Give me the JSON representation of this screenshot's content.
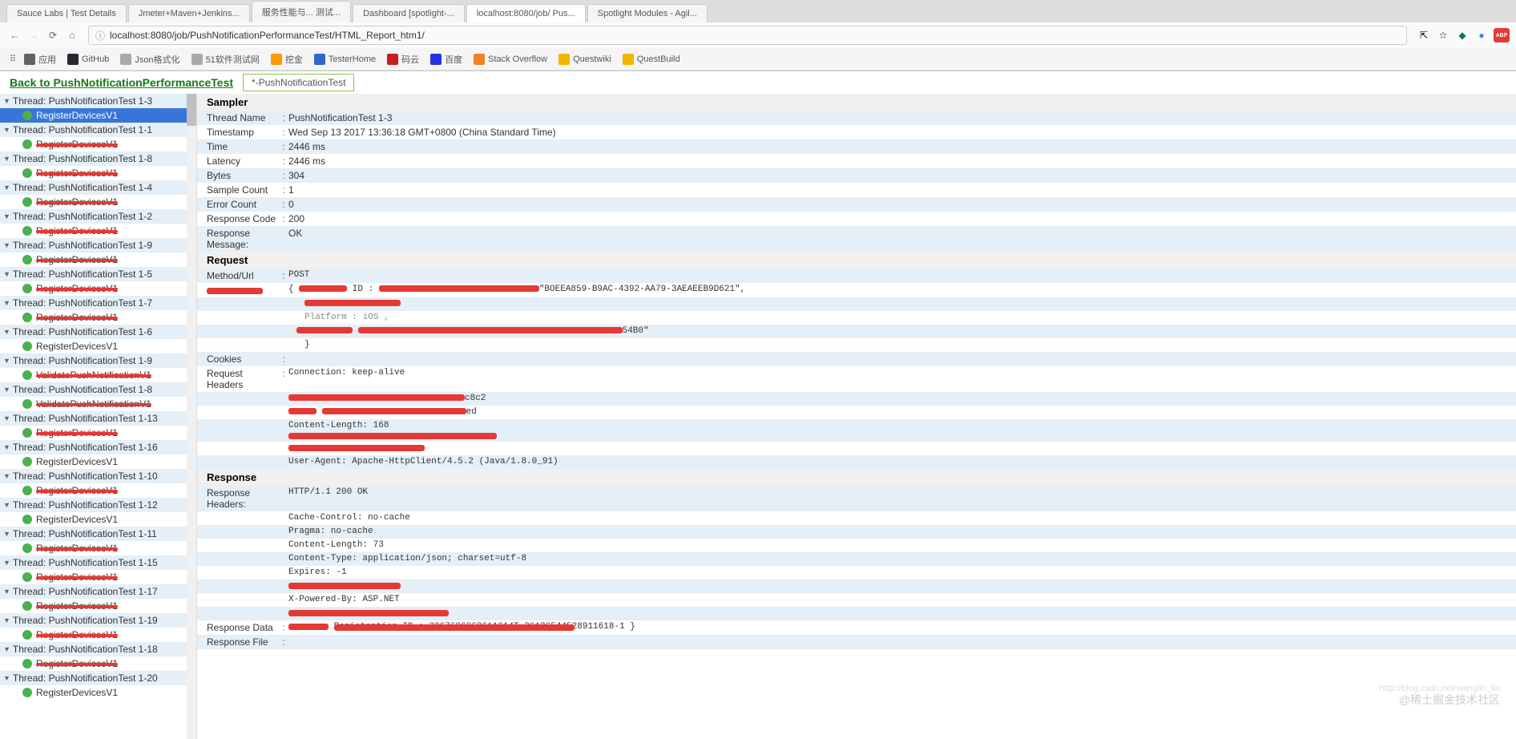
{
  "browser": {
    "url": "localhost:8080/job/PushNotificationPerformanceTest/HTML_Report_htm1/",
    "tabs": [
      {
        "label": "Sauce Labs | Test Details"
      },
      {
        "label": "Jmeter+Maven+Jenkins..."
      },
      {
        "label": "服务性能与... 测试..."
      },
      {
        "label": "Dashboard [spotlight-..."
      },
      {
        "label": "localhost:8080/job/ Pus..."
      },
      {
        "label": "Spotlight Modules - Agil..."
      }
    ],
    "bookmarks": [
      {
        "label": "应用",
        "color": "#5f6368"
      },
      {
        "label": "GitHub",
        "color": "#24292e"
      },
      {
        "label": "Json格式化",
        "color": "#aaa"
      },
      {
        "label": "51软件测试网",
        "color": "#aaa"
      },
      {
        "label": "挖金",
        "color": "#f90"
      },
      {
        "label": "TesterHome",
        "color": "#36c"
      },
      {
        "label": "码云",
        "color": "#c71d23"
      },
      {
        "label": "百度",
        "color": "#2932e1"
      },
      {
        "label": "Stack Overflow",
        "color": "#f48024"
      },
      {
        "label": "Questwiki",
        "color": "#f4b400"
      },
      {
        "label": "QuestBuild",
        "color": "#f4b400"
      }
    ]
  },
  "header": {
    "back_link": "Back to PushNotificationPerformanceTest",
    "tab": "*-PushNotificationTest"
  },
  "tree": [
    {
      "t": "thread",
      "label": "Thread: PushNotificationTest 1-3",
      "sel": false
    },
    {
      "t": "leaf",
      "label": "RegisterDevicesV1",
      "sel": true,
      "red": false
    },
    {
      "t": "thread",
      "label": "Thread: PushNotificationTest 1-1"
    },
    {
      "t": "leaf",
      "label": "RegisterDevicesV1",
      "red": true
    },
    {
      "t": "thread",
      "label": "Thread: PushNotificationTest 1-8"
    },
    {
      "t": "leaf",
      "label": "RegisterDevicesV1",
      "red": true
    },
    {
      "t": "thread",
      "label": "Thread: PushNotificationTest 1-4"
    },
    {
      "t": "leaf",
      "label": "RegisterDevicesV1",
      "red": true
    },
    {
      "t": "thread",
      "label": "Thread: PushNotificationTest 1-2"
    },
    {
      "t": "leaf",
      "label": "RegisterDevicesV1",
      "red": true,
      "short": true
    },
    {
      "t": "thread",
      "label": "Thread: PushNotificationTest 1-9"
    },
    {
      "t": "leaf",
      "label": "RegisterDevicesV1",
      "red": true,
      "short": true
    },
    {
      "t": "thread",
      "label": "Thread: PushNotificationTest 1-5"
    },
    {
      "t": "leaf",
      "label": "RegisterDevicesV1",
      "red": true
    },
    {
      "t": "thread",
      "label": "Thread: PushNotificationTest 1-7"
    },
    {
      "t": "leaf",
      "label": "RegisterDevicesV1",
      "red": true
    },
    {
      "t": "thread",
      "label": "Thread: PushNotificationTest 1-6"
    },
    {
      "t": "leaf",
      "label": "RegisterDevicesV1",
      "red": false
    },
    {
      "t": "thread",
      "label": "Thread: PushNotificationTest 1-9"
    },
    {
      "t": "leaf",
      "label": "ValidatePushNotificationV1",
      "red": true
    },
    {
      "t": "thread",
      "label": "Thread: PushNotificationTest 1-8"
    },
    {
      "t": "leaf",
      "label": "ValidatePushNotificationV1",
      "red": true
    },
    {
      "t": "thread",
      "label": "Thread: PushNotificationTest 1-13"
    },
    {
      "t": "leaf",
      "label": "RegisterDevicesV1",
      "red": true,
      "short": true
    },
    {
      "t": "thread",
      "label": "Thread: PushNotificationTest 1-16"
    },
    {
      "t": "leaf",
      "label": "RegisterDevicesV1",
      "red": false
    },
    {
      "t": "thread",
      "label": "Thread: PushNotificationTest 1-10"
    },
    {
      "t": "leaf",
      "label": "RegisterDevicesV1",
      "red": true
    },
    {
      "t": "thread",
      "label": "Thread: PushNotificationTest 1-12"
    },
    {
      "t": "leaf",
      "label": "RegisterDevicesV1",
      "red": false
    },
    {
      "t": "thread",
      "label": "Thread: PushNotificationTest 1-11"
    },
    {
      "t": "leaf",
      "label": "RegisterDevicesV1",
      "red": true
    },
    {
      "t": "thread",
      "label": "Thread: PushNotificationTest 1-15"
    },
    {
      "t": "leaf",
      "label": "RegisterDevicesV1",
      "red": true,
      "short": true
    },
    {
      "t": "thread",
      "label": "Thread: PushNotificationTest 1-17"
    },
    {
      "t": "leaf",
      "label": "RegisterDevicesV1",
      "red": true
    },
    {
      "t": "thread",
      "label": "Thread: PushNotificationTest 1-19"
    },
    {
      "t": "leaf",
      "label": "RegisterDevicesV1",
      "red": true
    },
    {
      "t": "thread",
      "label": "Thread: PushNotificationTest 1-18"
    },
    {
      "t": "leaf",
      "label": "RegisterDevicesV1",
      "red": true,
      "short": true
    },
    {
      "t": "thread",
      "label": "Thread: PushNotificationTest 1-20"
    },
    {
      "t": "leaf",
      "label": "RegisterDevicesV1",
      "red": false
    }
  ],
  "sampler": {
    "hdr": "Sampler",
    "rows": [
      {
        "k": "Thread Name",
        "v": "PushNotificationTest 1-3"
      },
      {
        "k": "Timestamp",
        "v": "Wed Sep 13 2017 13:36:18 GMT+0800 (China Standard Time)"
      },
      {
        "k": "Time",
        "v": "2446 ms"
      },
      {
        "k": "Latency",
        "v": "2446 ms"
      },
      {
        "k": "Bytes",
        "v": "304"
      },
      {
        "k": "Sample Count",
        "v": "1"
      },
      {
        "k": "Error Count",
        "v": "0"
      },
      {
        "k": "Response Code",
        "v": "200"
      },
      {
        "k": "Response Message:",
        "v": "OK",
        "nosep": true
      }
    ]
  },
  "request": {
    "hdr": "Request",
    "method": {
      "k": "Method/Url",
      "v": "POST"
    },
    "query_tail": "\"BOEEA859-B9AC-4392-AA79-3AEAEEB9D621\",",
    "platform": "Platform : iOS ,",
    "tail54b0": "54B0\"",
    "brace": "}",
    "cookies": {
      "k": "Cookies",
      "v": ""
    },
    "reqhdr": {
      "k": "Request Headers",
      "v": "Connection: keep-alive"
    },
    "h2_tail": "c8c2",
    "h3_tail": "ed",
    "contlen": "Content-Length: 168",
    "ua": "User-Agent: Apache-HttpClient/4.5.2 (Java/1.8.0_91)"
  },
  "response": {
    "hdr": "Response",
    "rh": {
      "k": "Response Headers:",
      "v": "HTTP/1.1 200 OK"
    },
    "lines": [
      "Cache-Control: no-cache",
      "Pragma: no-cache",
      "Content-Length: 73",
      "Content-Type: application/json; charset=utf-8",
      "Expires: -1"
    ],
    "xpb": "X-Powered-By: ASP.NET",
    "rd": {
      "k": "Response Data",
      "tail": "Registration ID : 2267606062611014T-26126544528911618-1 }"
    },
    "rf": {
      "k": "Response File",
      "v": ""
    }
  },
  "watermark": {
    "main": "@稀土掘金技术社区",
    "sub": "http://blog.csdn.net/wanglin_lin"
  }
}
